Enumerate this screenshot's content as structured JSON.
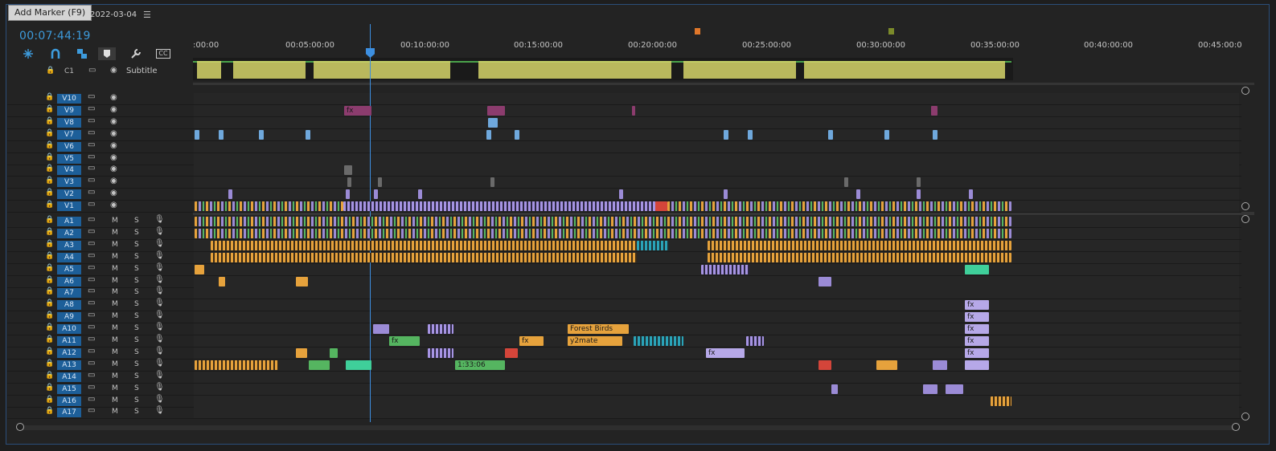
{
  "window": {
    "tooltip": "Add Marker (F9)",
    "sequence_name": "2022-03-04",
    "menu_icon": "hamburger-icon",
    "timecode": "00:07:44:19"
  },
  "toolbar": {
    "tools": [
      {
        "icon": "ripple-insert-icon"
      },
      {
        "icon": "snap-magnet-icon"
      },
      {
        "icon": "linked-selection-icon"
      },
      {
        "icon": "add-marker-icon"
      },
      {
        "icon": "wrench-settings-icon"
      },
      {
        "icon": "captions-icon",
        "label": "CC"
      }
    ]
  },
  "ruler": {
    "labels": [
      ":00:00",
      "00:05:00:00",
      "00:10:00:00",
      "00:15:00:00",
      "00:20:00:00",
      "00:25:00:00",
      "00:30:00:00",
      "00:35:00:00",
      "00:40:00:00",
      "00:45:00:0"
    ],
    "markers": [
      {
        "color": "#e0772a"
      },
      {
        "color": "#7b8a2a"
      }
    ]
  },
  "subtitle_header": {
    "c1_label": "C1",
    "subtitle_label": "Subtitle"
  },
  "video_tracks": [
    "V10",
    "V9",
    "V8",
    "V7",
    "V6",
    "V5",
    "V4",
    "V3",
    "V2",
    "V1"
  ],
  "audio_tracks": [
    "A1",
    "A2",
    "A3",
    "A4",
    "A5",
    "A6",
    "A7",
    "A8",
    "A9",
    "A10",
    "A11",
    "A12",
    "A13",
    "A14",
    "A15",
    "A16",
    "A17"
  ],
  "audio_track_buttons": {
    "mute": "M",
    "solo": "S"
  },
  "clips": {
    "forest_birds": "Forest Birds",
    "y2mate": "y2mate",
    "clip_tc_a": "1:33:06",
    "fx": "fx"
  },
  "colors": {
    "accent_blue": "#3d8fe0",
    "track_blue": "#1d5f99",
    "orange": "#e6a23c",
    "purple": "#9b8bd6",
    "green": "#55b560",
    "teal": "#2aa3b8"
  }
}
